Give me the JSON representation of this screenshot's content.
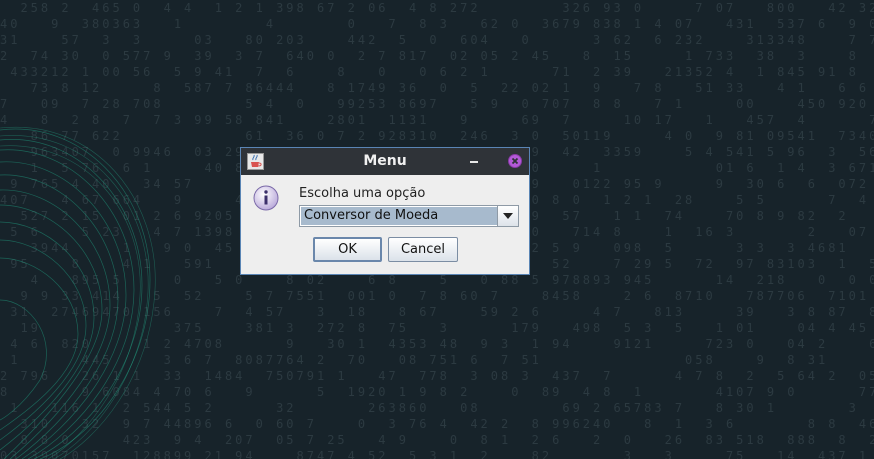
{
  "dialog": {
    "title": "Menu",
    "prompt": "Escolha uma opção",
    "selected_option": "Conversor de Moeda",
    "ok_label": "OK",
    "cancel_label": "Cancel"
  },
  "icons": {
    "app": "java-cup-icon",
    "minimize": "minimize-icon",
    "close": "close-icon",
    "info": "info-icon",
    "dropdown": "chevron-down-icon"
  },
  "colors": {
    "desktop_bg": "#17232a",
    "titlebar_bg": "#2f3338",
    "close_accent": "#b45ad8",
    "selection_bg": "#a7bacd"
  }
}
